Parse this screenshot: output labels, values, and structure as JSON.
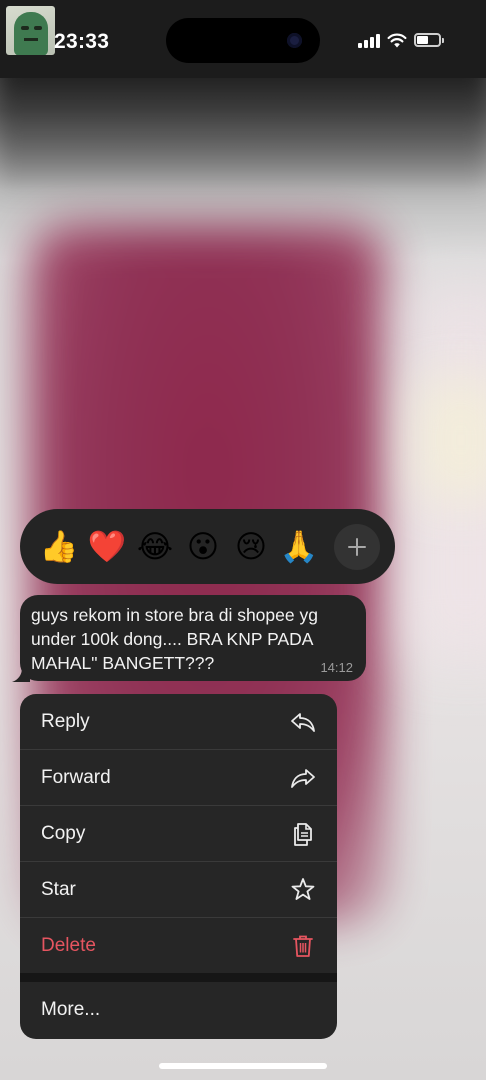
{
  "status_bar": {
    "time": "23:33",
    "avatar_icon": "green-cartoon-avatar",
    "signal_icon": "cellular-signal-icon",
    "wifi_icon": "wifi-icon",
    "battery_icon": "battery-icon"
  },
  "reactions": {
    "items": [
      {
        "name": "thumbs-up",
        "glyph": "👍"
      },
      {
        "name": "red-heart",
        "glyph": "❤️"
      },
      {
        "name": "tears-of-joy",
        "glyph": "😂"
      },
      {
        "name": "surprised",
        "glyph": "😮"
      },
      {
        "name": "crying",
        "glyph": "😢"
      },
      {
        "name": "folded-hands",
        "glyph": "🙏"
      }
    ],
    "more_icon": "plus-icon"
  },
  "message": {
    "text": "guys rekom in store bra di shopee yg under 100k dong.... BRA KNP PADA MAHAL\" BANGETT???",
    "time": "14:12"
  },
  "menu": {
    "reply": "Reply",
    "forward": "Forward",
    "copy": "Copy",
    "star": "Star",
    "delete": "Delete",
    "more": "More..."
  },
  "colors": {
    "background_blur": "#8c2a4f",
    "panel": "#262626",
    "text": "#f2f2f2",
    "destructive": "#e65560"
  }
}
